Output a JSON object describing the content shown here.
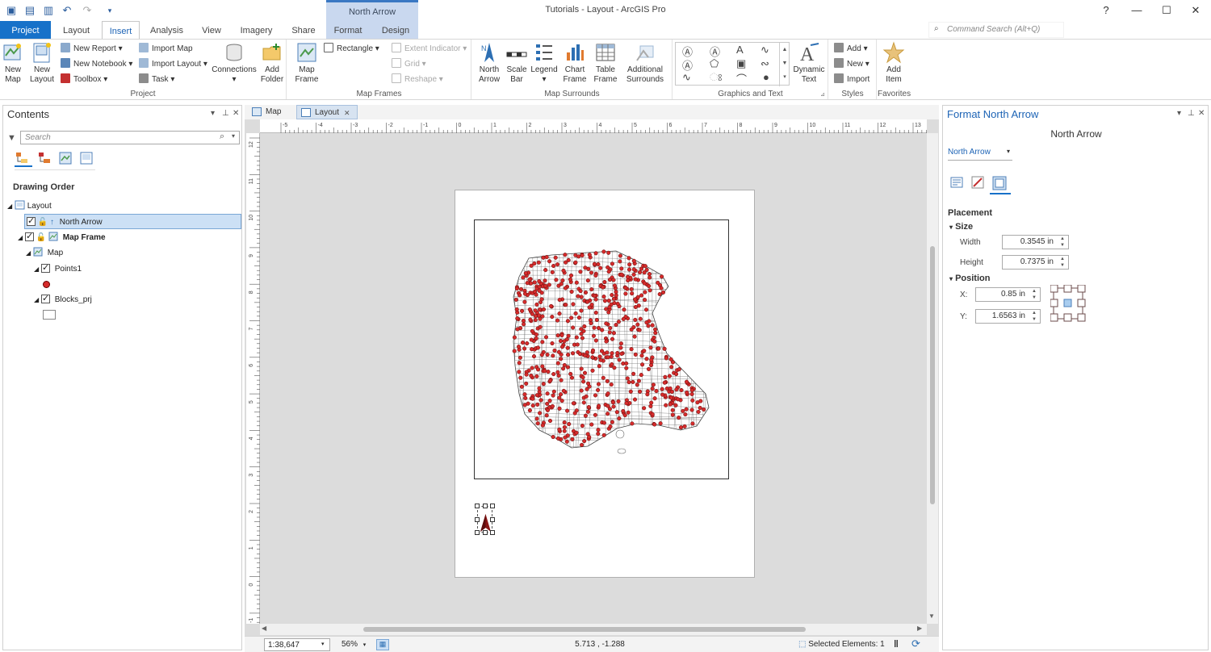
{
  "titlebar": {
    "app_title": "Tutorials - Layout - ArcGIS Pro",
    "contextual_header": "North Arrow",
    "minimize": "—",
    "maximize": "☐",
    "close": "✕",
    "help": "?"
  },
  "tabs": [
    "Project",
    "Layout",
    "Insert",
    "Analysis",
    "View",
    "Imagery",
    "Share",
    "Format",
    "Design"
  ],
  "active_tab": "Insert",
  "command_search": {
    "placeholder": "Command Search (Alt+Q)"
  },
  "ribbon": {
    "project": {
      "label": "Project",
      "new_map": "New\nMap",
      "new_layout": "New\nLayout",
      "new_report": "New Report",
      "new_notebook": "New Notebook",
      "toolbox": "Toolbox",
      "import_map": "Import Map",
      "import_layout": "Import Layout",
      "task": "Task",
      "connections": "Connections",
      "add_folder": "Add\nFolder"
    },
    "map_frames": {
      "label": "Map Frames",
      "map_frame": "Map\nFrame",
      "rectangle": "Rectangle",
      "extent_indicator": "Extent Indicator",
      "grid": "Grid",
      "reshape": "Reshape"
    },
    "map_surrounds": {
      "label": "Map Surrounds",
      "north_arrow": "North\nArrow",
      "scale_bar": "Scale\nBar",
      "legend": "Legend",
      "chart_frame": "Chart\nFrame",
      "table_frame": "Table\nFrame",
      "additional_surrounds": "Additional\nSurrounds"
    },
    "graphics_text": {
      "label": "Graphics and Text",
      "dynamic_text": "Dynamic\nText"
    },
    "styles": {
      "label": "Styles",
      "add": "Add",
      "new": "New",
      "import": "Import"
    },
    "favorites": {
      "label": "Favorites",
      "add_item": "Add\nItem"
    }
  },
  "contents": {
    "title": "Contents",
    "search_placeholder": "Search",
    "section": "Drawing Order",
    "tree": [
      {
        "label": "Layout",
        "level": 0
      },
      {
        "label": "North Arrow",
        "level": 1,
        "selected": true
      },
      {
        "label": "Map Frame",
        "level": 1,
        "bold": true
      },
      {
        "label": "Map",
        "level": 2
      },
      {
        "label": "Points1",
        "level": 3
      },
      {
        "label": "Blocks_prj",
        "level": 3
      }
    ]
  },
  "views": [
    {
      "label": "Map"
    },
    {
      "label": "Layout",
      "active": true
    }
  ],
  "ruler": {
    "h_ticks": [
      "-5",
      "-4",
      "-3",
      "-2",
      "-1",
      "0",
      "1",
      "2",
      "3",
      "4",
      "5",
      "6",
      "7",
      "8",
      "9",
      "10",
      "11",
      "12",
      "13"
    ],
    "v_ticks": [
      "12",
      "11",
      "10",
      "9",
      "8",
      "7",
      "6",
      "5",
      "4",
      "3",
      "2",
      "1",
      "0",
      "-1"
    ]
  },
  "status": {
    "scale": "1:38,647",
    "zoom": "56%",
    "coords": "5.713 , -1.288",
    "selected": "Selected Elements: 1"
  },
  "format_pane": {
    "title": "Format North Arrow",
    "subtitle": "North Arrow",
    "element_select": "North Arrow",
    "placement": "Placement",
    "size": "Size",
    "width_label": "Width",
    "width_value": "0.3545 in",
    "height_label": "Height",
    "height_value": "0.7375 in",
    "position": "Position",
    "x_label": "X:",
    "x_value": "0.85 in",
    "y_label": "Y:",
    "y_value": "1.6563 in"
  },
  "colors": {
    "accent": "#1771c9",
    "point_fill": "#d62b2b",
    "selection": "#cce0f5",
    "north_arrow": "#8b1515"
  }
}
